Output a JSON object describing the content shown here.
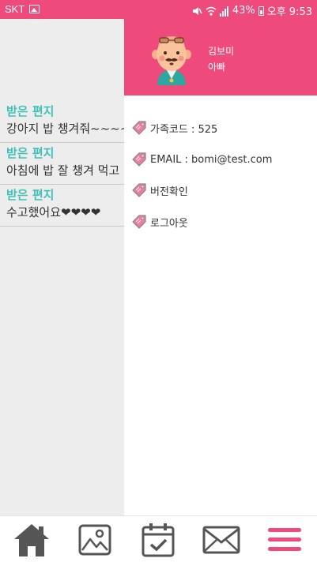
{
  "status_bar": {
    "carrier": "SKT",
    "battery": "43%",
    "clock": "오후 9:53",
    "icons": [
      "image-notification-icon",
      "mute-icon",
      "wifi-icon",
      "signal-icon",
      "battery-icon"
    ]
  },
  "letters": [
    {
      "title": "받은 편지",
      "body": "강아지 밥 챙겨줘~~~~"
    },
    {
      "title": "받은 편지",
      "body": "아침에 밥 잘 챙겨 먹고 가"
    },
    {
      "title": "받은 편지",
      "body": "수고했어요❤❤❤❤"
    }
  ],
  "drawer": {
    "profile": {
      "name": "김보미",
      "role": "아빠"
    },
    "menu": [
      {
        "label": "가족코드 : 525",
        "icon": "tag-icon"
      },
      {
        "label": "EMAIL :  bomi@test.com",
        "icon": "tag-icon"
      },
      {
        "label": "버전확인",
        "icon": "tag-icon"
      },
      {
        "label": "로그아웃",
        "icon": "tag-icon"
      }
    ]
  },
  "bottom_nav": [
    {
      "icon": "home-icon"
    },
    {
      "icon": "gallery-icon"
    },
    {
      "icon": "calendar-check-icon"
    },
    {
      "icon": "mail-icon"
    },
    {
      "icon": "menu-icon"
    }
  ],
  "colors": {
    "accent": "#ee4a7c",
    "letter_title": "#3fc1b8",
    "nav_icon": "#555555",
    "nav_active": "#ee4a7c",
    "tag_pink": "#f07aa0"
  }
}
